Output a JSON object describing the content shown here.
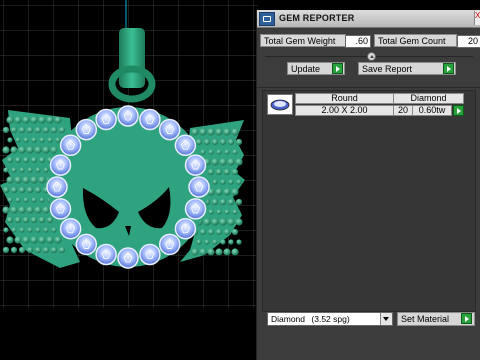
{
  "panel": {
    "title": "GEM REPORTER",
    "close_glyph": "X",
    "total_weight_label": "Total Gem Weight",
    "total_weight_value": ".60",
    "total_count_label": "Total Gem Count",
    "total_count_value": "20",
    "update_label": "Update",
    "save_report_label": "Save Report"
  },
  "results": {
    "headers": [
      "Round",
      "Diamond"
    ],
    "rows": [
      {
        "icon": "round-gem-icon",
        "size": "2.00 X 2.00",
        "count": "20",
        "weight": "0.60tw"
      }
    ]
  },
  "material": {
    "selected": "Diamond",
    "spg": "(3.52 spg)",
    "set_label": "Set Material"
  },
  "colors": {
    "model_green": "#2fa27f",
    "gem_blue": "#6d8fe6",
    "go_green": "#26a13c",
    "grid_line": "#3a3a3a"
  }
}
